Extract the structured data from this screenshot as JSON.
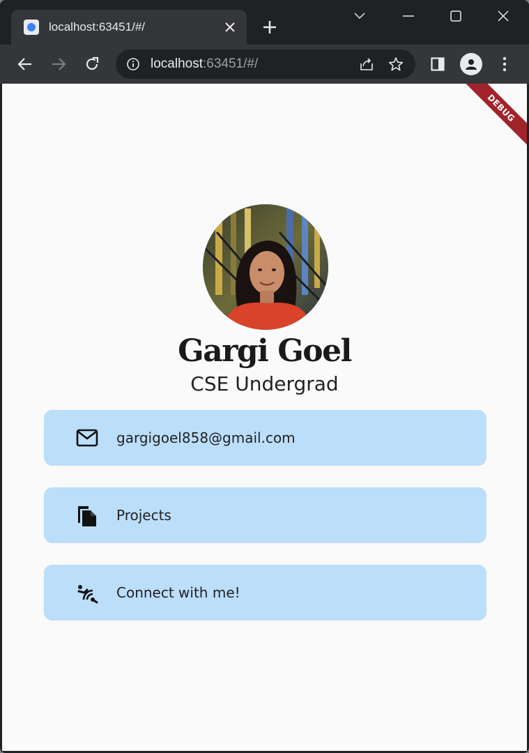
{
  "browser": {
    "tab_title": "localhost:63451/#/",
    "url_host": "localhost",
    "url_rest": ":63451/#/"
  },
  "debug_banner": "DEBUG",
  "profile": {
    "name": "Gargi Goel",
    "subtitle": "CSE Undergrad"
  },
  "cards": [
    {
      "label": "gargigoel858@gmail.com",
      "icon": "mail-icon"
    },
    {
      "label": "Projects",
      "icon": "file-copy-icon"
    },
    {
      "label": "Connect with me!",
      "icon": "connect-signal-icon"
    }
  ],
  "colors": {
    "card_bg": "#bbdefb",
    "page_bg": "#fafafa",
    "debug_banner": "#a1242b"
  }
}
